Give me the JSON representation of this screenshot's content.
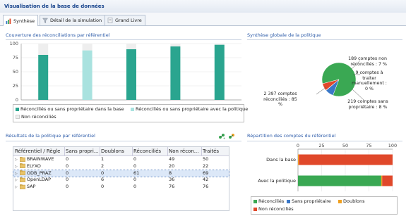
{
  "window_title": "Visualisation de la base de données",
  "tabs": [
    {
      "label": "Synthèse",
      "icon": "bar-chart-icon",
      "active": true
    },
    {
      "label": "Détail de la simulation",
      "icon": "funnel-icon",
      "active": false
    },
    {
      "label": "Grand Livre",
      "icon": "book-icon",
      "active": false
    }
  ],
  "coverage": {
    "title": "Couverture des réconciliations par référentiel",
    "legend": [
      {
        "label": "Réconciliés ou sans propriétaire dans la base",
        "color": "#2aa58f"
      },
      {
        "label": "Réconciliés ou sans propriétaire avec la politique",
        "color": "#a9e2df"
      },
      {
        "label": "Non réconciliés",
        "color": "#eeeeee"
      }
    ]
  },
  "synthesis": {
    "title": "Synthèse globale de la politique",
    "labels": {
      "non_reconciled": "189 comptes non réconciliés : 7 %",
      "manual": "9 comptes à traiter manuellement : 0 %",
      "no_owner": "219 comptes sans propriétaire : 8 %",
      "reconciled": "2 397 comptes réconciliés : 85 %"
    }
  },
  "results": {
    "title": "Résultats de la politique par référentiel",
    "columns": [
      "Référentiel / Règle",
      "Sans propri...",
      "Doublons",
      "Réconciliés",
      "Non récon...",
      "Traités"
    ],
    "rows": [
      {
        "name": "BRAINWAVE",
        "sans": "0",
        "doublons": "1",
        "reconcilies": "0",
        "non": "49",
        "traites": "50",
        "selected": false
      },
      {
        "name": "ELYXO",
        "sans": "0",
        "doublons": "2",
        "reconcilies": "0",
        "non": "20",
        "traites": "22",
        "selected": false
      },
      {
        "name": "ODB_PRAZ",
        "sans": "0",
        "doublons": "0",
        "reconcilies": "61",
        "non": "8",
        "traites": "69",
        "selected": true
      },
      {
        "name": "OpenLDAP",
        "sans": "0",
        "doublons": "6",
        "reconcilies": "0",
        "non": "36",
        "traites": "42",
        "selected": false
      },
      {
        "name": "SAP",
        "sans": "0",
        "doublons": "0",
        "reconcilies": "0",
        "non": "76",
        "traites": "76",
        "selected": false
      }
    ]
  },
  "repartition": {
    "title": "Répartition des comptes du référentiel",
    "legend": [
      {
        "label": "Réconciliés",
        "color": "#3aa853"
      },
      {
        "label": "Sans propriétaire",
        "color": "#3a78c8"
      },
      {
        "label": "Doublons",
        "color": "#f0a020"
      },
      {
        "label": "Non réconciliés",
        "color": "#e0482a"
      }
    ]
  },
  "chart_data": [
    {
      "type": "bar",
      "title": "Couverture des réconciliations par référentiel",
      "xlabel": "",
      "ylabel": "",
      "ylim": [
        0,
        100
      ],
      "yticks": [
        "0",
        "25",
        "50",
        "75",
        "100"
      ],
      "stacked": true,
      "series": [
        {
          "name": "Réconciliés ou sans propriétaire dans la base",
          "color": "#2aa58f",
          "values": [
            80,
            0,
            90,
            95,
            98
          ]
        },
        {
          "name": "Réconciliés ou sans propriétaire avec la politique",
          "color": "#a9e2df",
          "values": [
            0,
            88,
            0,
            0,
            0
          ]
        },
        {
          "name": "Non réconciliés",
          "color": "#eeeeee",
          "values": [
            20,
            12,
            10,
            5,
            2
          ]
        }
      ],
      "categories": [
        "",
        "",
        "",
        "",
        ""
      ],
      "grid": true,
      "legend_position": "bottom"
    },
    {
      "type": "pie",
      "title": "Synthèse globale de la politique",
      "slices": [
        {
          "label": "2 397 comptes réconciliés : 85 %",
          "value": 85,
          "color": "#3aa853"
        },
        {
          "label": "219 comptes sans propriétaire : 8 %",
          "value": 8,
          "color": "#3a78c8"
        },
        {
          "label": "9 comptes à traiter manuellement : 0 %",
          "value": 0.3,
          "color": "#f0a020"
        },
        {
          "label": "189 comptes non réconciliés : 7 %",
          "value": 7,
          "color": "#e0482a"
        }
      ]
    },
    {
      "type": "bar",
      "orientation": "horizontal",
      "title": "Répartition des comptes du référentiel",
      "categories": [
        "Dans la base",
        "Avec la politique"
      ],
      "xlim": [
        0,
        100
      ],
      "xticks": [
        "0",
        "25",
        "50",
        "75",
        "100"
      ],
      "stacked": true,
      "series": [
        {
          "name": "Réconciliés",
          "color": "#3aa853",
          "values": [
            0,
            88
          ]
        },
        {
          "name": "Sans propriétaire",
          "color": "#3a78c8",
          "values": [
            0,
            0
          ]
        },
        {
          "name": "Doublons",
          "color": "#f0a020",
          "values": [
            1,
            1
          ]
        },
        {
          "name": "Non réconciliés",
          "color": "#e0482a",
          "values": [
            99,
            11
          ]
        }
      ],
      "grid": true,
      "legend_position": "bottom"
    }
  ]
}
